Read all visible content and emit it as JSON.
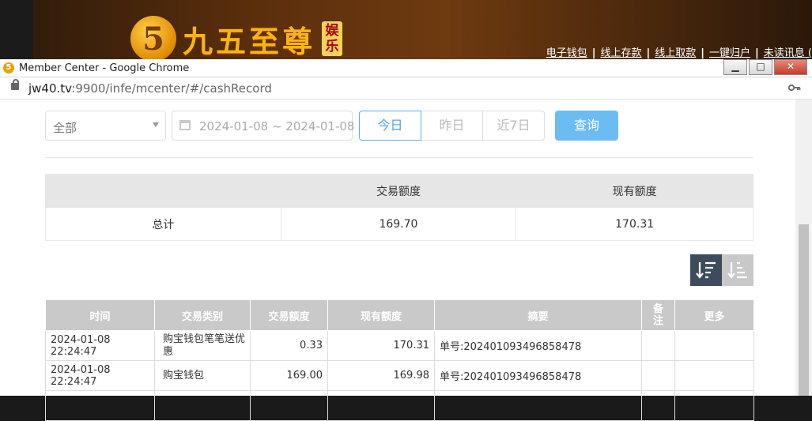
{
  "site": {
    "logo_text": "九五至尊",
    "logo_digit": "5",
    "logo_sub": "娱乐",
    "nav": [
      "电子钱包",
      "线上存款",
      "线上取款",
      "一键归户",
      "未读讯息 ("
    ]
  },
  "window": {
    "favicon": "5",
    "title": "Member Center - Google Chrome",
    "min_label": "▁",
    "max_label": "□",
    "close_label": "✕",
    "url_host": "jw40.tv",
    "url_path": ":9900/infe/mcenter/#/cashRecord",
    "key_icon": "key-icon"
  },
  "filters": {
    "type_value": "全部",
    "date_range": "2024-01-08 ~ 2024-01-08",
    "today": "今日",
    "yesterday": "昨日",
    "last7": "近7日",
    "query": "查询"
  },
  "summary": {
    "col_transaction": "交易额度",
    "col_balance": "现有额度",
    "total_label": "总计",
    "total_transaction": "169.70",
    "total_balance": "170.31"
  },
  "records": {
    "headers": [
      "时间",
      "交易类别",
      "交易额度",
      "现有额度",
      "摘要",
      "备注",
      "更多"
    ],
    "rows": [
      {
        "time": "2024-01-08 22:24:47",
        "type": "购宝钱包笔笔送优惠",
        "amount": "0.33",
        "balance": "170.31",
        "summary": "单号:202401093496858478",
        "note": "",
        "more": ""
      },
      {
        "time": "2024-01-08 22:24:47",
        "type": "购宝钱包",
        "amount": "169.00",
        "balance": "169.98",
        "summary": "单号:202401093496858478",
        "note": "",
        "more": ""
      }
    ]
  },
  "colors": {
    "primary": "#6cbcf3",
    "header_gray": "#c9c9c9",
    "sort_active": "#3e4b5c"
  }
}
